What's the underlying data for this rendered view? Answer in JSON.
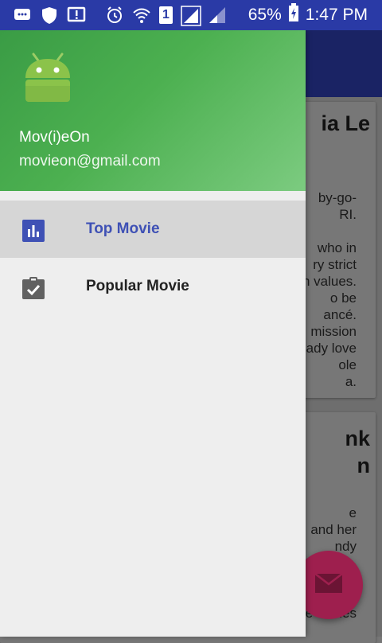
{
  "status_bar": {
    "sim_slot": "1",
    "battery_percent": "65%",
    "time": "1:47 PM",
    "icons": [
      "chat-icon",
      "shield-icon",
      "alert-icon",
      "alarm-icon",
      "wifi-icon",
      "signal-icon",
      "signal-2-icon",
      "battery-charging-icon"
    ]
  },
  "drawer": {
    "header": {
      "name": "Mov(i)eOn",
      "email": "movieon@gmail.com",
      "avatar_icon": "android-icon"
    },
    "items": [
      {
        "label": "Top Movie",
        "icon": "bar-chart-icon",
        "selected": true
      },
      {
        "label": "Popular Movie",
        "icon": "clipboard-check-icon",
        "selected": false
      }
    ]
  },
  "background": {
    "cards": [
      {
        "title": "ia Le",
        "text": "by-go-\nRI.\n\nwho in\nry strict\nn values.\no be\nancé.\nmission\nady love\nole\na."
      },
      {
        "title_line1": "nk",
        "title_line2": "n",
        "text": "e\nand her\nndy\n\n\nr ieig\ne comes"
      }
    ],
    "fab_icon": "mail-icon"
  },
  "colors": {
    "status_bar": "#2a3aa6",
    "accent": "#3f51b5",
    "header_green": "#4cb050",
    "fab": "#9e1f4e"
  }
}
